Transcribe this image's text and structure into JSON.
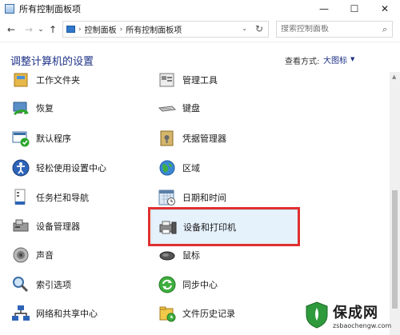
{
  "window": {
    "title": "所有控制面板项"
  },
  "titlebar_buttons": [
    "—",
    "☐",
    "✕"
  ],
  "nav": {
    "back": "←",
    "forward": "→",
    "recent": "⌄",
    "up": "↑"
  },
  "breadcrumb": [
    "控制面板",
    "所有控制面板项"
  ],
  "search": {
    "placeholder": "搜索控制面板"
  },
  "page": {
    "title": "调整计算机的设置"
  },
  "view_by": {
    "label": "查看方式:",
    "value": "大图标"
  },
  "left_items": [
    {
      "label": "工作文件夹",
      "icon": "work-folders-icon"
    },
    {
      "label": "恢复",
      "icon": "recovery-icon"
    },
    {
      "label": "默认程序",
      "icon": "default-programs-icon"
    },
    {
      "label": "轻松使用设置中心",
      "icon": "ease-of-access-icon"
    },
    {
      "label": "任务栏和导航",
      "icon": "taskbar-icon"
    },
    {
      "label": "设备管理器",
      "icon": "device-manager-icon"
    },
    {
      "label": "声音",
      "icon": "sound-icon"
    },
    {
      "label": "索引选项",
      "icon": "indexing-icon"
    },
    {
      "label": "网络和共享中心",
      "icon": "network-icon"
    }
  ],
  "right_items": [
    {
      "label": "管理工具",
      "icon": "admin-tools-icon"
    },
    {
      "label": "键盘",
      "icon": "keyboard-icon"
    },
    {
      "label": "凭据管理器",
      "icon": "credential-manager-icon"
    },
    {
      "label": "区域",
      "icon": "region-icon"
    },
    {
      "label": "日期和时间",
      "icon": "date-time-icon"
    },
    {
      "label": "设备和打印机",
      "icon": "devices-printers-icon"
    },
    {
      "label": "鼠标",
      "icon": "mouse-icon"
    },
    {
      "label": "同步中心",
      "icon": "sync-center-icon"
    },
    {
      "label": "文件历史记录",
      "icon": "file-history-icon"
    }
  ],
  "watermark": {
    "main": "保成网",
    "sub": "zsbaochengw.com"
  }
}
